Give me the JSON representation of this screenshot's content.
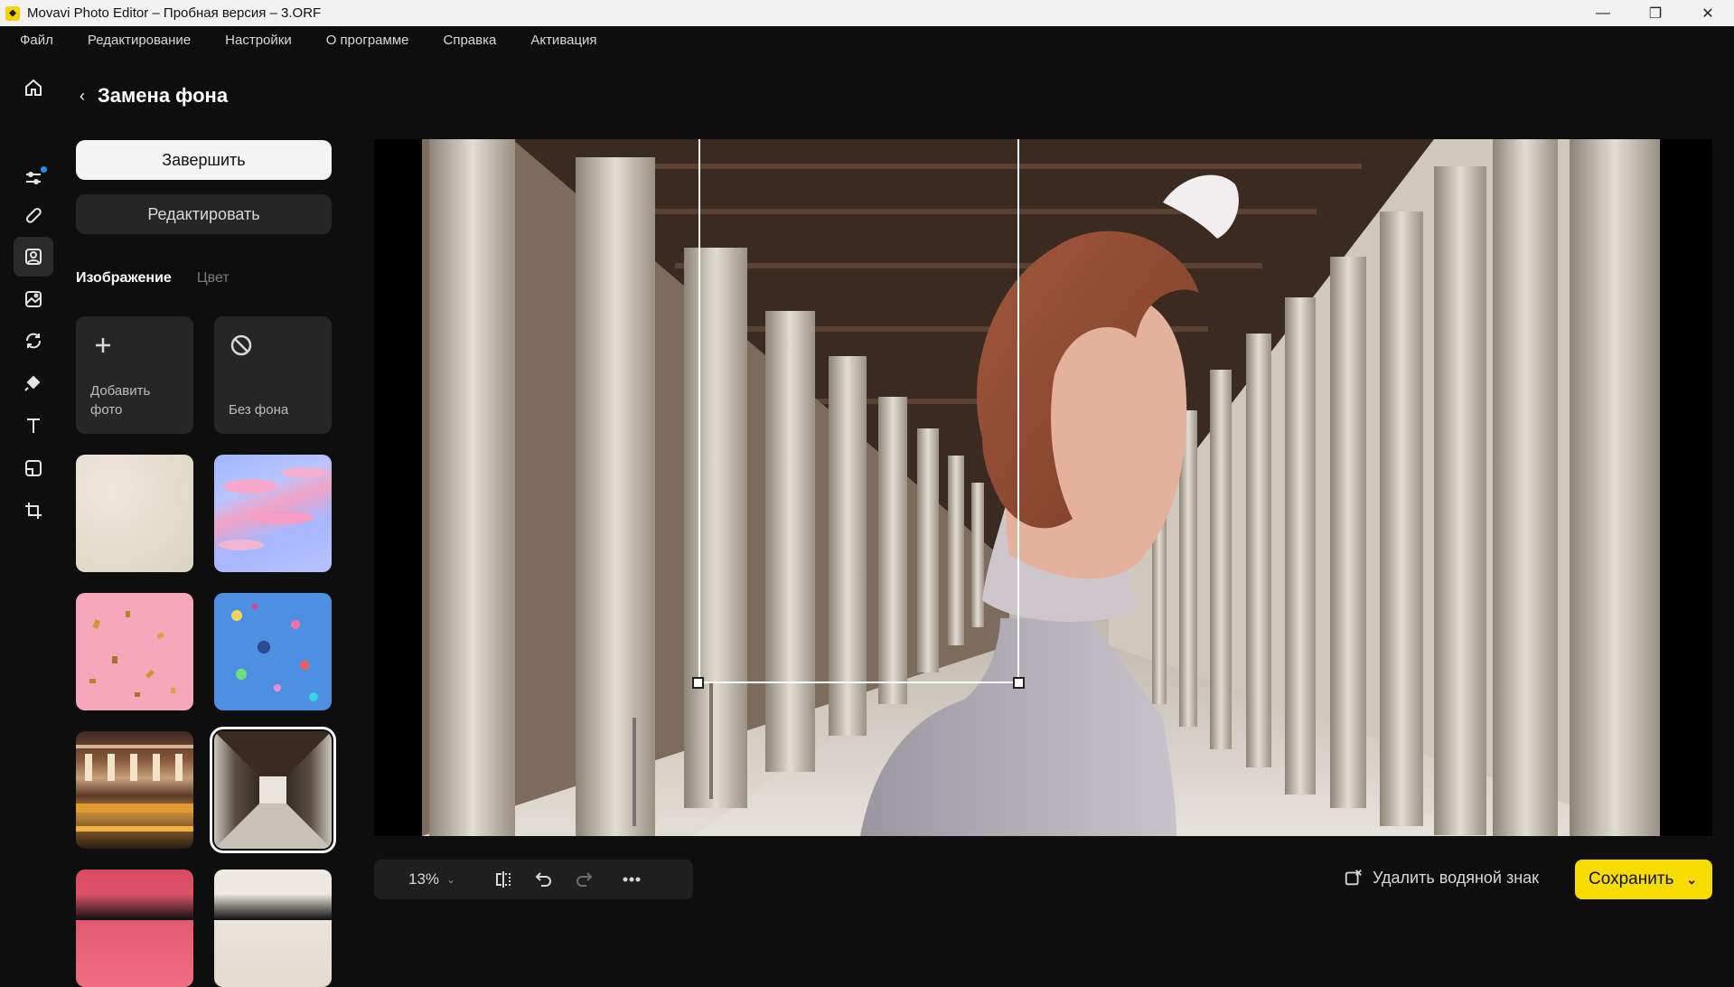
{
  "window": {
    "title": "Movavi Photo Editor – Пробная версия – 3.ORF",
    "minimize": "—",
    "maximize": "❐",
    "close": "✕"
  },
  "menu": [
    "Файл",
    "Редактирование",
    "Настройки",
    "О программе",
    "Справка",
    "Активация"
  ],
  "rail": [
    "home-icon",
    "adjust-icon",
    "retouch-icon",
    "background-icon",
    "enhance-icon",
    "transform-icon",
    "objects-icon",
    "text-icon",
    "frames-icon",
    "crop-icon"
  ],
  "panel": {
    "back": "‹",
    "title": "Замена фона",
    "finish_label": "Завершить",
    "edit_label": "Редактировать",
    "tab_image": "Изображение",
    "tab_color": "Цвет",
    "add_photo": "Добавить фото",
    "no_background": "Без фона"
  },
  "backgrounds": [
    "sand",
    "sky",
    "pink-confetti",
    "blue-confetti",
    "building",
    "colonnade",
    "red",
    "cream"
  ],
  "selected_background": "colonnade",
  "toolbar": {
    "zoom": "13%",
    "zoom_chevron": "⌄",
    "remove_watermark": "Удалить водяной знак",
    "save": "Сохранить",
    "save_chevron": "⌄"
  },
  "colors": {
    "accent": "#f7dc00",
    "notify_dot": "#1e90ff"
  }
}
